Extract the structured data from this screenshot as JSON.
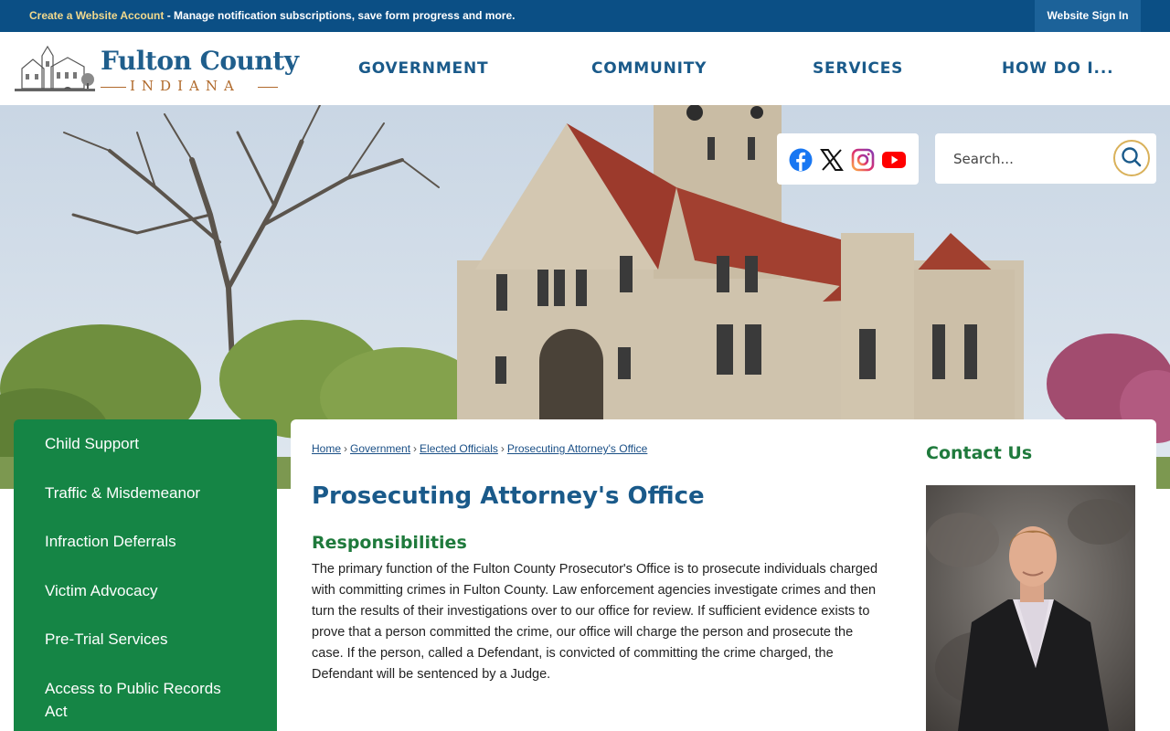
{
  "topbar": {
    "account_link": "Create a Website Account",
    "message": " - Manage notification subscriptions, save form progress and more.",
    "sign_in": "Website Sign In"
  },
  "logo": {
    "name": "Fulton County",
    "state": "INDIANA"
  },
  "nav": {
    "items": [
      "GOVERNMENT",
      "COMMUNITY",
      "SERVICES",
      "HOW DO I..."
    ]
  },
  "social": {
    "icons": [
      "facebook-icon",
      "x-icon",
      "instagram-icon",
      "youtube-icon"
    ]
  },
  "search": {
    "placeholder": "Search..."
  },
  "sidebar": {
    "items": [
      {
        "label": "Child Support"
      },
      {
        "label": "Traffic & Misdemeanor"
      },
      {
        "label": "Infraction Deferrals"
      },
      {
        "label": "Victim Advocacy"
      },
      {
        "label": "Pre-Trial Services"
      },
      {
        "label": "Access to Public Records Act"
      }
    ]
  },
  "breadcrumb": [
    "Home",
    "Government",
    "Elected Officials",
    "Prosecuting Attorney's Office"
  ],
  "main": {
    "title": "Prosecuting Attorney's Office",
    "subtitle": "Responsibilities",
    "body": "The primary function of the Fulton County Prosecutor's Office is to prosecute individuals charged with committing crimes in Fulton County. Law enforcement agencies investigate crimes and then turn the results of their investigations over to our office for review. If sufficient evidence exists to prove that a person committed the crime, our office will charge the person and prosecute the case. If the person, called a Defendant, is convicted of committing the crime charged, the Defendant will be sentenced by a Judge."
  },
  "contact": {
    "title": "Contact Us"
  },
  "colors": {
    "topbar": "#0b4f85",
    "nav_text": "#1a5a8a",
    "sidebar_green": "#158545",
    "heading_green": "#1f7a3c",
    "accent_gold": "#d9b15a"
  }
}
